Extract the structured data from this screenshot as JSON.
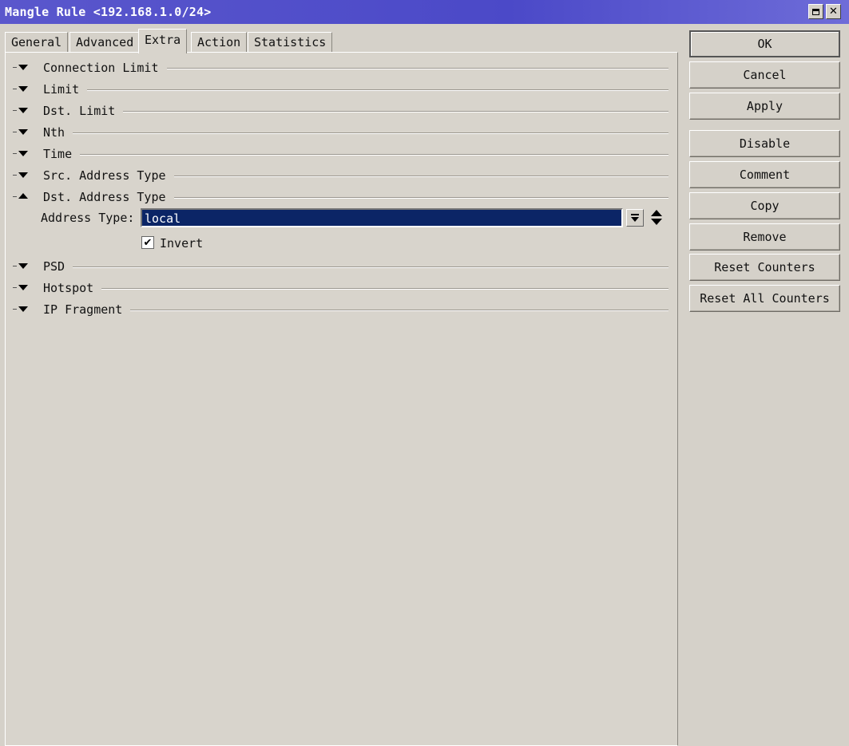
{
  "window": {
    "title": "Mangle Rule <192.168.1.0/24>",
    "maximize_icon": "maximize-icon",
    "close_icon": "close-icon",
    "close_glyph": "✕"
  },
  "tabs": [
    {
      "label": "General",
      "active": false
    },
    {
      "label": "Advanced",
      "active": false
    },
    {
      "label": "Extra",
      "active": true
    },
    {
      "label": "Action",
      "active": false
    },
    {
      "label": "Statistics",
      "active": false
    }
  ],
  "sections": [
    {
      "label": "Connection Limit",
      "expanded": false
    },
    {
      "label": "Limit",
      "expanded": false
    },
    {
      "label": "Dst. Limit",
      "expanded": false
    },
    {
      "label": "Nth",
      "expanded": false
    },
    {
      "label": "Time",
      "expanded": false
    },
    {
      "label": "Src. Address Type",
      "expanded": false
    },
    {
      "label": "Dst. Address Type",
      "expanded": true
    },
    {
      "label": "PSD",
      "expanded": false
    },
    {
      "label": "Hotspot",
      "expanded": false
    },
    {
      "label": "IP Fragment",
      "expanded": false
    }
  ],
  "dst_address_type": {
    "field_label": "Address Type:",
    "value": "local",
    "invert_label": "Invert",
    "invert_checked": true,
    "check_glyph": "✔"
  },
  "buttons": [
    {
      "label": "OK"
    },
    {
      "label": "Cancel"
    },
    {
      "label": "Apply"
    },
    {
      "label": "Disable"
    },
    {
      "label": "Comment"
    },
    {
      "label": "Copy"
    },
    {
      "label": "Remove"
    },
    {
      "label": "Reset Counters"
    },
    {
      "label": "Reset All Counters"
    }
  ],
  "colors": {
    "titlebar": "#4b49c8",
    "selected_field": "#0b2566",
    "background": "#d5d1c9"
  }
}
